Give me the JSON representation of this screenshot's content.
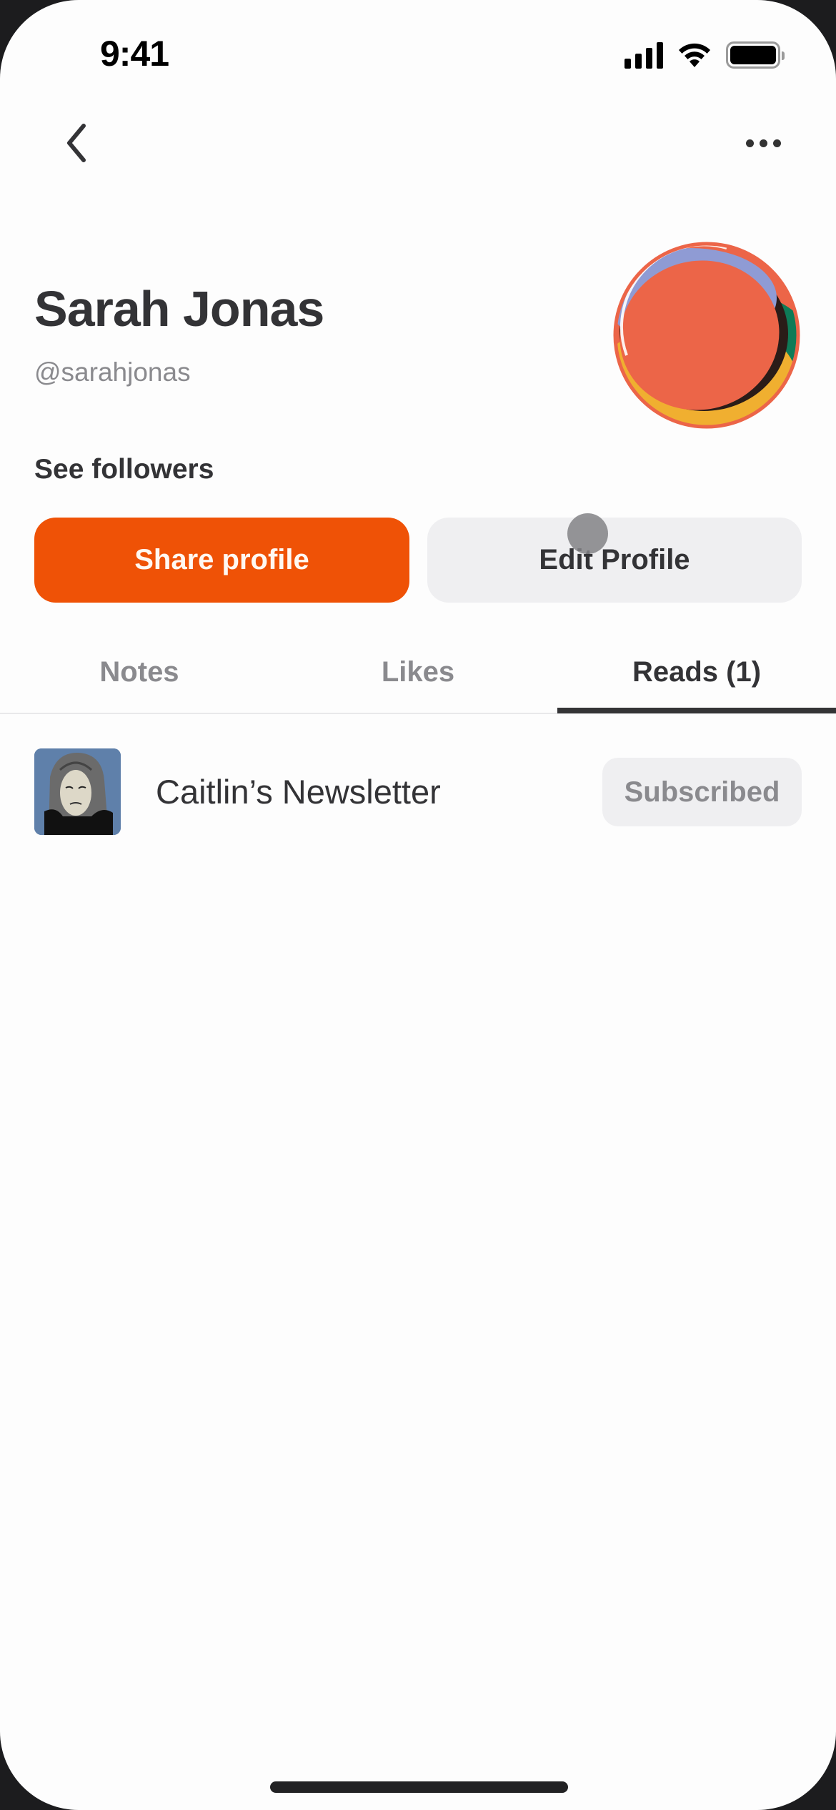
{
  "status_bar": {
    "time": "9:41",
    "icons": [
      "cellular-signal-icon",
      "wifi-icon",
      "battery-icon"
    ]
  },
  "nav": {
    "back_icon": "chevron-left-icon",
    "more_icon": "ellipsis-icon"
  },
  "profile": {
    "name": "Sarah Jonas",
    "handle": "@sarahjonas",
    "followers_link": "See followers",
    "avatar": "abstract-colored-sphere"
  },
  "actions": {
    "share_label": "Share profile",
    "edit_label": "Edit Profile"
  },
  "tabs": [
    {
      "label": "Notes",
      "active": false
    },
    {
      "label": "Likes",
      "active": false
    },
    {
      "label": "Reads (1)",
      "active": true
    }
  ],
  "reads": [
    {
      "title": "Caitlin’s Newsletter",
      "status": "Subscribed",
      "thumbnail": "illustrated-portrait"
    }
  ],
  "colors": {
    "accent": "#ef5206",
    "secondary_button": "#efeff1",
    "text_primary": "#333336",
    "text_secondary": "#8a8a8e"
  }
}
